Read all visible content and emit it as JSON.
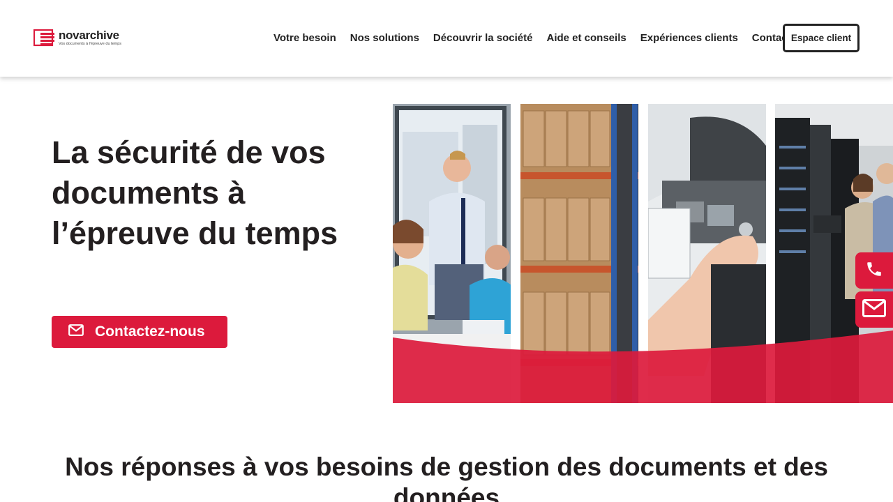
{
  "brand": {
    "name": "novarchive",
    "tagline": "Vos documents à l'épreuve du temps",
    "accent_color": "#dc1a3c"
  },
  "nav": {
    "items": [
      {
        "label": "Votre besoin"
      },
      {
        "label": "Nos solutions"
      },
      {
        "label": "Découvrir la société"
      },
      {
        "label": "Aide et conseils"
      },
      {
        "label": "Expériences clients"
      },
      {
        "label": "Contact"
      }
    ],
    "espace_client": "Espace client"
  },
  "hero": {
    "title_line1": "La sécurité de vos",
    "title_line2": "documents à",
    "title_line3": "l’épreuve du temps",
    "cta_label": "Contactez-nous",
    "cta_icon": "envelope-icon",
    "images": [
      "office-meeting-photo",
      "warehouse-shelves-photo",
      "scanner-photo",
      "server-room-photo"
    ]
  },
  "side_actions": [
    {
      "icon": "phone-icon"
    },
    {
      "icon": "envelope-icon"
    }
  ],
  "section": {
    "title": "Nos réponses à vos besoins de gestion des documents et des données"
  }
}
